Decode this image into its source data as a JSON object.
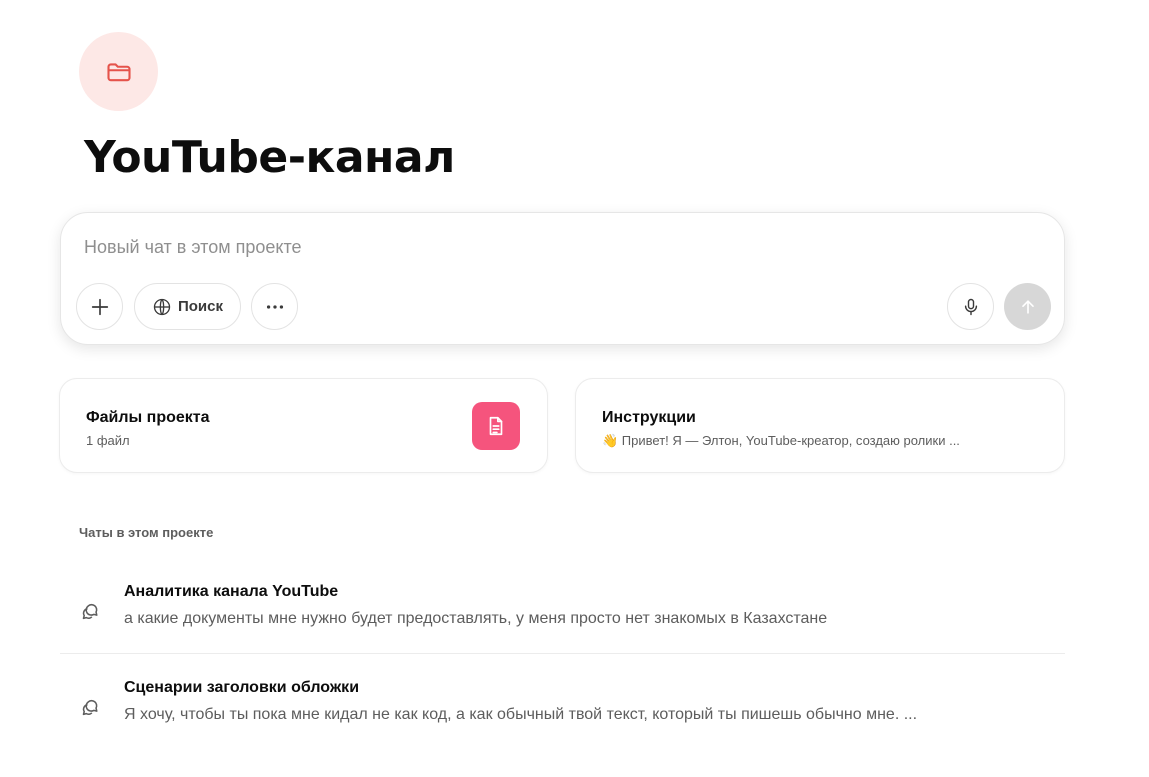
{
  "project": {
    "icon": "folder-icon",
    "title": "YouTube-канал",
    "accent_color": "#e5534b"
  },
  "composer": {
    "placeholder": "Новый чат в этом проекте",
    "search_label": "Поиск",
    "icons": [
      "plus-icon",
      "globe-icon",
      "more-icon",
      "mic-icon",
      "arrow-up-icon"
    ]
  },
  "cards": {
    "files": {
      "title": "Файлы проекта",
      "subtitle": "1 файл",
      "badge_color": "#f5547d"
    },
    "instructions": {
      "title": "Инструкции",
      "subtitle": "👋 Привет! Я — Элтон, YouTube-креатор, создаю ролики ..."
    }
  },
  "chats": {
    "section_label": "Чаты в этом проекте",
    "items": [
      {
        "title": "Аналитика канала YouTube",
        "preview": "а какие документы мне нужно будет предоставлять, у меня просто нет знакомых в Казахстане"
      },
      {
        "title": "Сценарии заголовки обложки",
        "preview": "Я хочу, чтобы ты пока мне кидал не как код, а как обычный твой текст, который ты пишешь обычно мне. ..."
      }
    ]
  }
}
